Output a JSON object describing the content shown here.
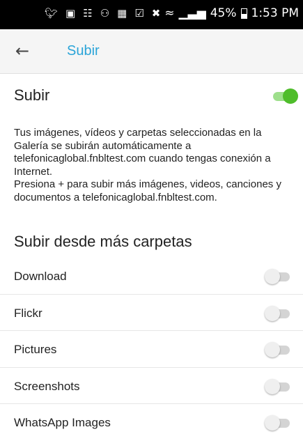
{
  "status_bar": {
    "icons": [
      "twitter-icon",
      "image-icon",
      "voicemail-icon",
      "add-contact-icon",
      "calendar-icon",
      "clipboard-icon",
      "mute-icon",
      "wifi-icon",
      "signal-icon"
    ],
    "battery": "45%",
    "time": "1:53 PM"
  },
  "app_bar": {
    "title": "Subir"
  },
  "upload": {
    "label": "Subir",
    "enabled": true
  },
  "description": {
    "paragraph_1": "Tus imágenes, vídeos y carpetas seleccionadas en la Galería se subirán automáticamente a telefonicaglobal.fnbltest.com cuando tengas conexión a Internet.",
    "paragraph_2": "Presiona + para subir más imágenes, videos, canciones y documentos a telefonicaglobal.fnbltest.com."
  },
  "folders": {
    "section_title": "Subir desde más carpetas",
    "items": [
      {
        "label": "Download",
        "enabled": false
      },
      {
        "label": "Flickr",
        "enabled": false
      },
      {
        "label": "Pictures",
        "enabled": false
      },
      {
        "label": "Screenshots",
        "enabled": false
      },
      {
        "label": "WhatsApp Images",
        "enabled": false
      }
    ]
  },
  "colors": {
    "accent": "#2aa4d8",
    "toggle_on": "#4fbd2b",
    "toggle_off": "#efefef"
  }
}
